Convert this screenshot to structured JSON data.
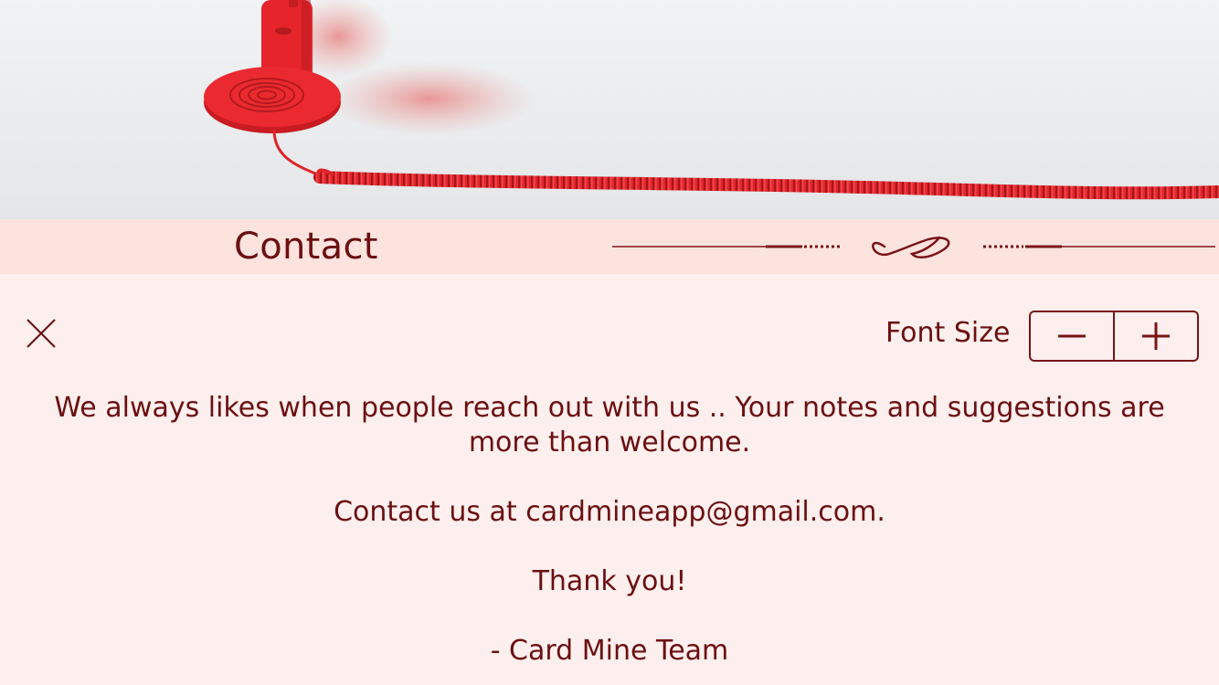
{
  "header": {
    "title": "Contact",
    "hero_image": "red-telephone-handset-photo",
    "ornament": "flourish-divider"
  },
  "toolbar": {
    "close_icon": "close-icon",
    "font_size_label": "Font Size",
    "decrease_icon": "minus-icon",
    "increase_icon": "plus-icon"
  },
  "body": {
    "intro": "We always likes when people reach out with us .. Your notes and suggestions are more than welcome.",
    "contact_line": "Contact us at cardmineapp@gmail.com.",
    "thanks": "Thank you!",
    "signature": "- Card Mine Team"
  },
  "colors": {
    "accent": "#6b0f12",
    "background": "#fdefed",
    "title_bar": "#fde3de",
    "phone_red": "#e8242b"
  }
}
